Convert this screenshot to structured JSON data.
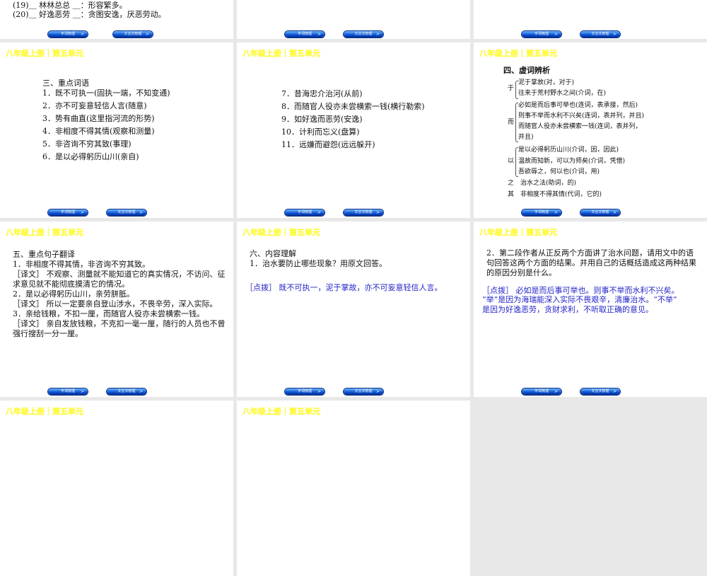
{
  "nav": {
    "btn1": "字词梳理",
    "btn2": "文言文梳理",
    "arrow": ">"
  },
  "header": "八年级上册｜第五单元",
  "s0": {
    "l19": "(19)＿ 林林总总 ＿：形容繁多。",
    "l20": "(20)＿ 好逸恶劳 ＿：贪图安逸，厌恶劳动。"
  },
  "s3": {
    "title": "三、重点词语",
    "items": [
      "1．既不可执一(固执一端，不知变通)",
      "2．亦不可妄意轻信人言(随意)",
      "3．势有曲直(这里指河流的形势)",
      "4．非相度不得其情(观察和测量)",
      "5．非咨询不穷其致(事理)",
      "6．是以必得躬历山川(亲自)"
    ]
  },
  "s4": {
    "items": [
      "7．昔海忠介治河(从前)",
      "8．而随官人役亦未尝横索一钱(横行勒索)",
      "9．如好逸而恶劳(安逸)",
      "10．计利而忘义(盘算)",
      "11．远嫌而避怨(远远躲开)"
    ]
  },
  "s5": {
    "title": "四、虚词辨析",
    "groups": [
      {
        "word": "于",
        "lines": [
          "泥于掌故(对，对于)",
          "往来于荒村野水之间(介词，在)"
        ]
      },
      {
        "word": "而",
        "lines": [
          "必如是而后事可举也(连词，表承接，然后)",
          "则事不举而水利不兴矣(连词，表并列，并且)",
          "而随官人役亦未尝横索一钱(连词，表并列，",
          "并且)"
        ]
      },
      {
        "word": "以",
        "lines": [
          "是以必得躬历山川(介词，因，因此)",
          "温故而知新，可以为师矣(介词，凭借)",
          "吾欲辱之，何以也(介词，用)"
        ]
      },
      {
        "word": "之",
        "lines": [
          "治水之法(助词，的)"
        ]
      },
      {
        "word": "其",
        "lines": [
          "非相度不得其情(代词，它的)"
        ]
      }
    ]
  },
  "s6": {
    "lines": [
      "五、重点句子翻译",
      "1．非相度不得其情，非咨询不穷其致。",
      "［译文］ 不观察、测量就不能知道它的真实情况，不访问、征",
      "求意见就不能彻底摸清它的情况。",
      "2．是以必得躬历山川，亲劳胼胝。",
      "［译文］ 所以一定要亲自登山涉水，不畏辛劳，深入实际。",
      "3．亲给钱粮，不扣一厘，而随官人役亦未尝横索一钱。",
      "［译文］ 亲自发放钱粮，不克扣一毫一厘，随行的人员也不曾",
      "强行搜刮一分一厘。"
    ]
  },
  "s7": {
    "title": "六、内容理解",
    "q": "1．治水要防止哪些现象？用原文回答。",
    "a": "［点拨］ 既不可执一，泥于掌故，亦不可妄意轻信人言。"
  },
  "s8": {
    "q": [
      "2．第二段作者从正反两个方面讲了治水问题，请用文中的语",
      "句回答这两个方面的结果。并用自己的话概括造成这两种结果",
      "的原因分别是什么。"
    ],
    "a": [
      "［点拨］ 必如是而后事可举也。则事不举而水利不兴矣。",
      "“举”是因为海瑞能深入实际不畏艰辛，清廉治水。“不举”",
      "是因为好逸恶劳，贪财求利，不听取正确的意见。"
    ]
  }
}
